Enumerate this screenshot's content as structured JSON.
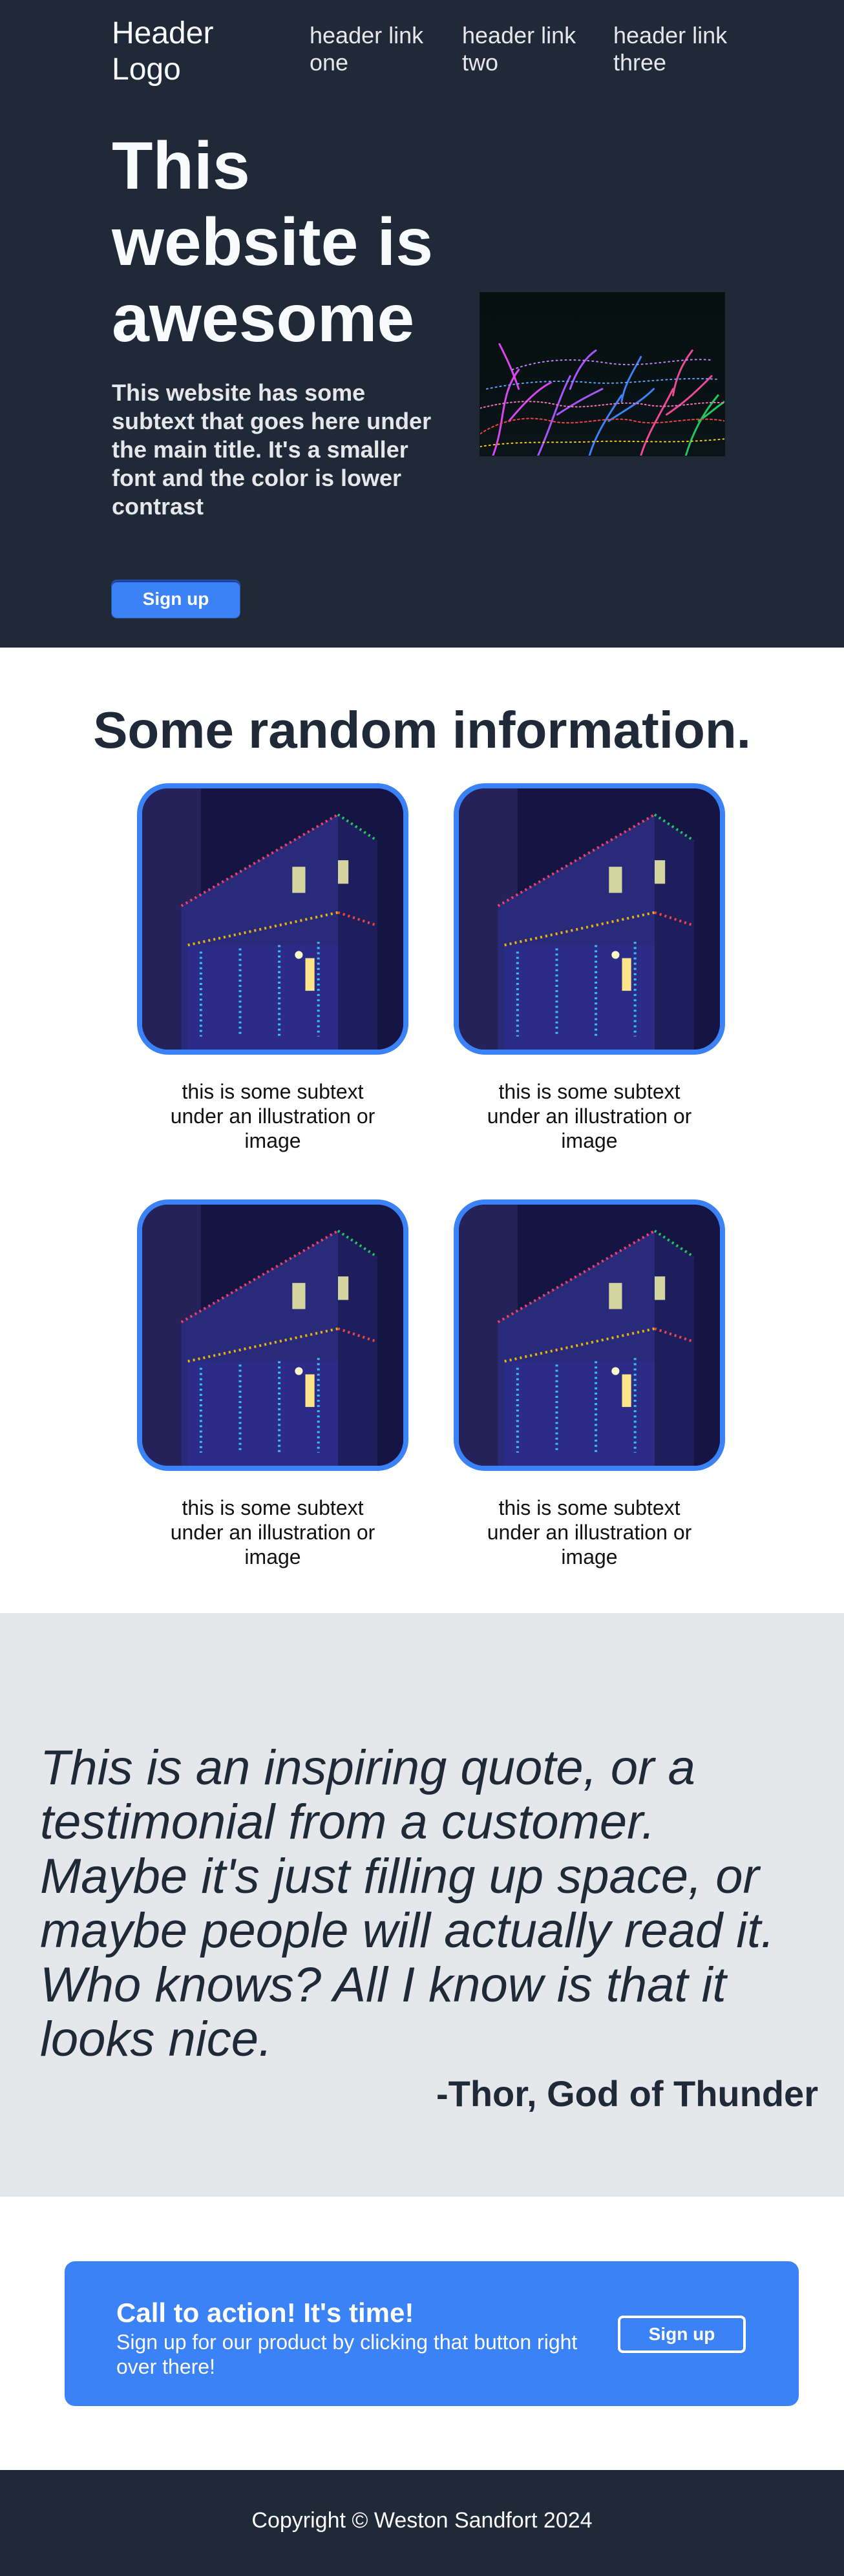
{
  "header": {
    "logo": "Header Logo",
    "links": [
      "header link one",
      "header link two",
      "header link three"
    ]
  },
  "hero": {
    "title": "This website is awesome",
    "subtitle": "This website has some subtext that goes here under the main title. It's a smaller font and the color is lower contrast",
    "button_label": "Sign up",
    "image_icon": "lights-in-trees-photo"
  },
  "info": {
    "title": "Some random information.",
    "cards": [
      {
        "caption": "this is some subtext under an illustration or image",
        "image_icon": "decorated-house-photo"
      },
      {
        "caption": "this is some subtext under an illustration or image",
        "image_icon": "decorated-house-photo"
      },
      {
        "caption": "this is some subtext under an illustration or image",
        "image_icon": "decorated-house-photo"
      },
      {
        "caption": "this is some subtext under an illustration or image",
        "image_icon": "decorated-house-photo"
      }
    ]
  },
  "quote": {
    "text": "This is an inspiring quote, or a testimonial from a customer. Maybe it's just filling up space, or maybe people will actually read it. Who knows? All I know is that it looks nice.",
    "author": "-Thor, God of Thunder"
  },
  "cta": {
    "title": "Call to action! It's time!",
    "subtitle": "Sign up for our product by clicking that button right over there!",
    "button_label": "Sign up"
  },
  "footer": {
    "copyright": "Copyright © Weston Sandfort 2024"
  },
  "colors": {
    "dark": "#1f2937",
    "accent": "#3b82f6",
    "light_gray": "#e5e7eb",
    "white": "#ffffff"
  }
}
